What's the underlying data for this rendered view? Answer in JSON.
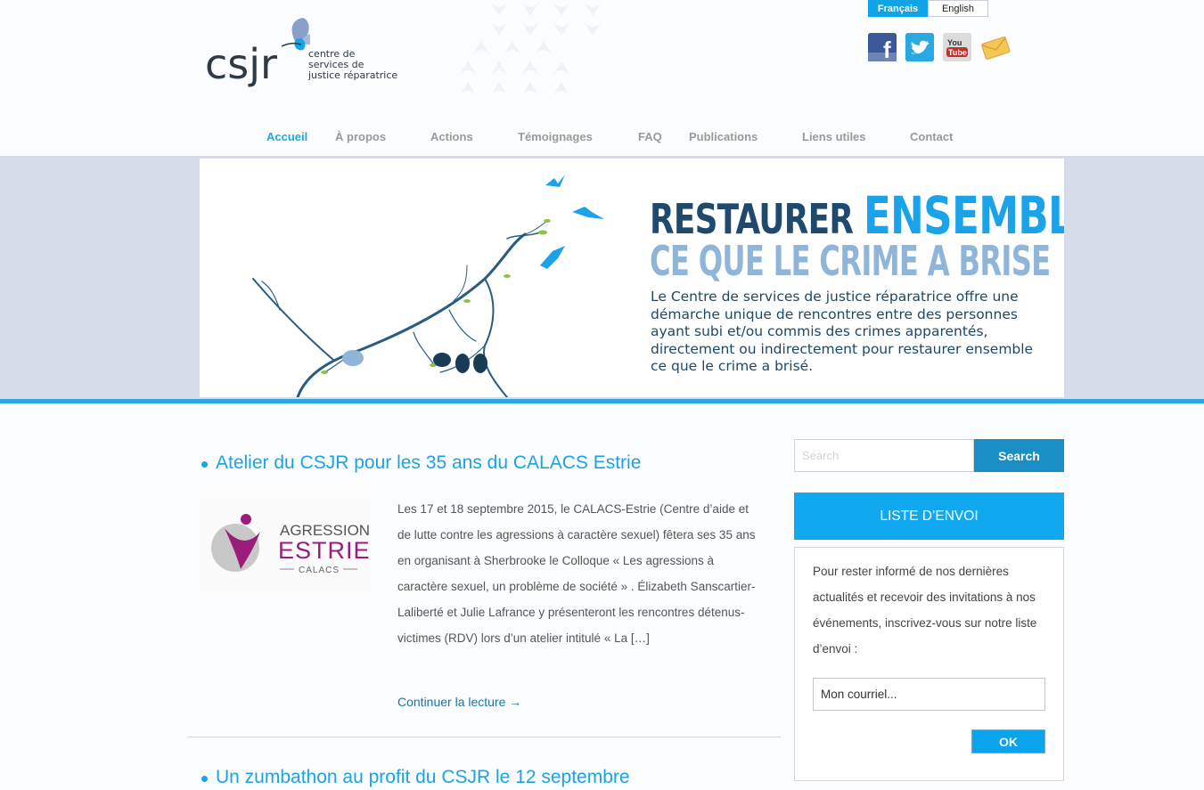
{
  "header": {
    "logo_letters": "csjr",
    "logo_lines": [
      "centre de",
      "services de",
      "justice réparatrice"
    ],
    "languages": [
      "Français",
      "English"
    ],
    "active_language": "Français",
    "social": [
      {
        "name": "facebook-icon",
        "glyph": "f"
      },
      {
        "name": "twitter-icon",
        "glyph": "t"
      },
      {
        "name": "youtube-icon",
        "glyph": "You Tube"
      },
      {
        "name": "mail-icon",
        "glyph": ""
      }
    ]
  },
  "nav": {
    "items": [
      "Accueil",
      "À propos",
      "Actions",
      "Témoignages",
      "FAQ",
      "Publications",
      "Liens utiles",
      "Contact"
    ],
    "active": "Accueil"
  },
  "banner": {
    "headline_dark": "RESTAURER",
    "headline_light": "ENSEMBLE",
    "subheadline": "CE QUE LE CRIME A BRISE",
    "description": "Le Centre de services de justice réparatrice offre une démarche unique de rencontres entre des personnes ayant subi et/ou commis des crimes apparentés, directement ou indirectement pour restaurer ensemble ce que le crime a brisé."
  },
  "posts": [
    {
      "title": "Atelier du CSJR pour les 35 ans du CALACS Estrie",
      "image_logo": {
        "line1": "AGRESSION",
        "line2": "ESTRIE",
        "line3": "CALACS"
      },
      "excerpt": "Les 17 et 18 septembre 2015, le CALACS-Estrie (Centre d’aide et de lutte contre les agressions à caractère sexuel) fêtera ses 35 ans en organisant à Sherbrooke le Colloque « Les agressions à caractère sexuel, un problème de société » . Élizabeth Sanscartier-Laliberté et Julie Lafrance y présenteront les rencontres détenus-victimes (RDV) lors d’un atelier intitulé « La […]",
      "read_more": "Continuer la lecture →"
    },
    {
      "title": "Un zumbathon au profit du CSJR le 12 septembre"
    }
  ],
  "sidebar": {
    "search_placeholder": "Search",
    "search_button": "Search",
    "newsletter_title": "LISTE D’ENVOI",
    "newsletter_text": "Pour rester informé de nos dernières actualités et recevoir des invitations à nos événements, inscrivez-vous sur notre liste d’envoi :",
    "email_value": "Mon courriel...",
    "ok_button": "OK"
  },
  "colors": {
    "accent": "#1ba3e4",
    "banner_band": "#d6dbe8",
    "headline_dark": "#1f4a6e",
    "headline_light": "#1aa3e8",
    "subheadline": "#8fb5d8"
  }
}
